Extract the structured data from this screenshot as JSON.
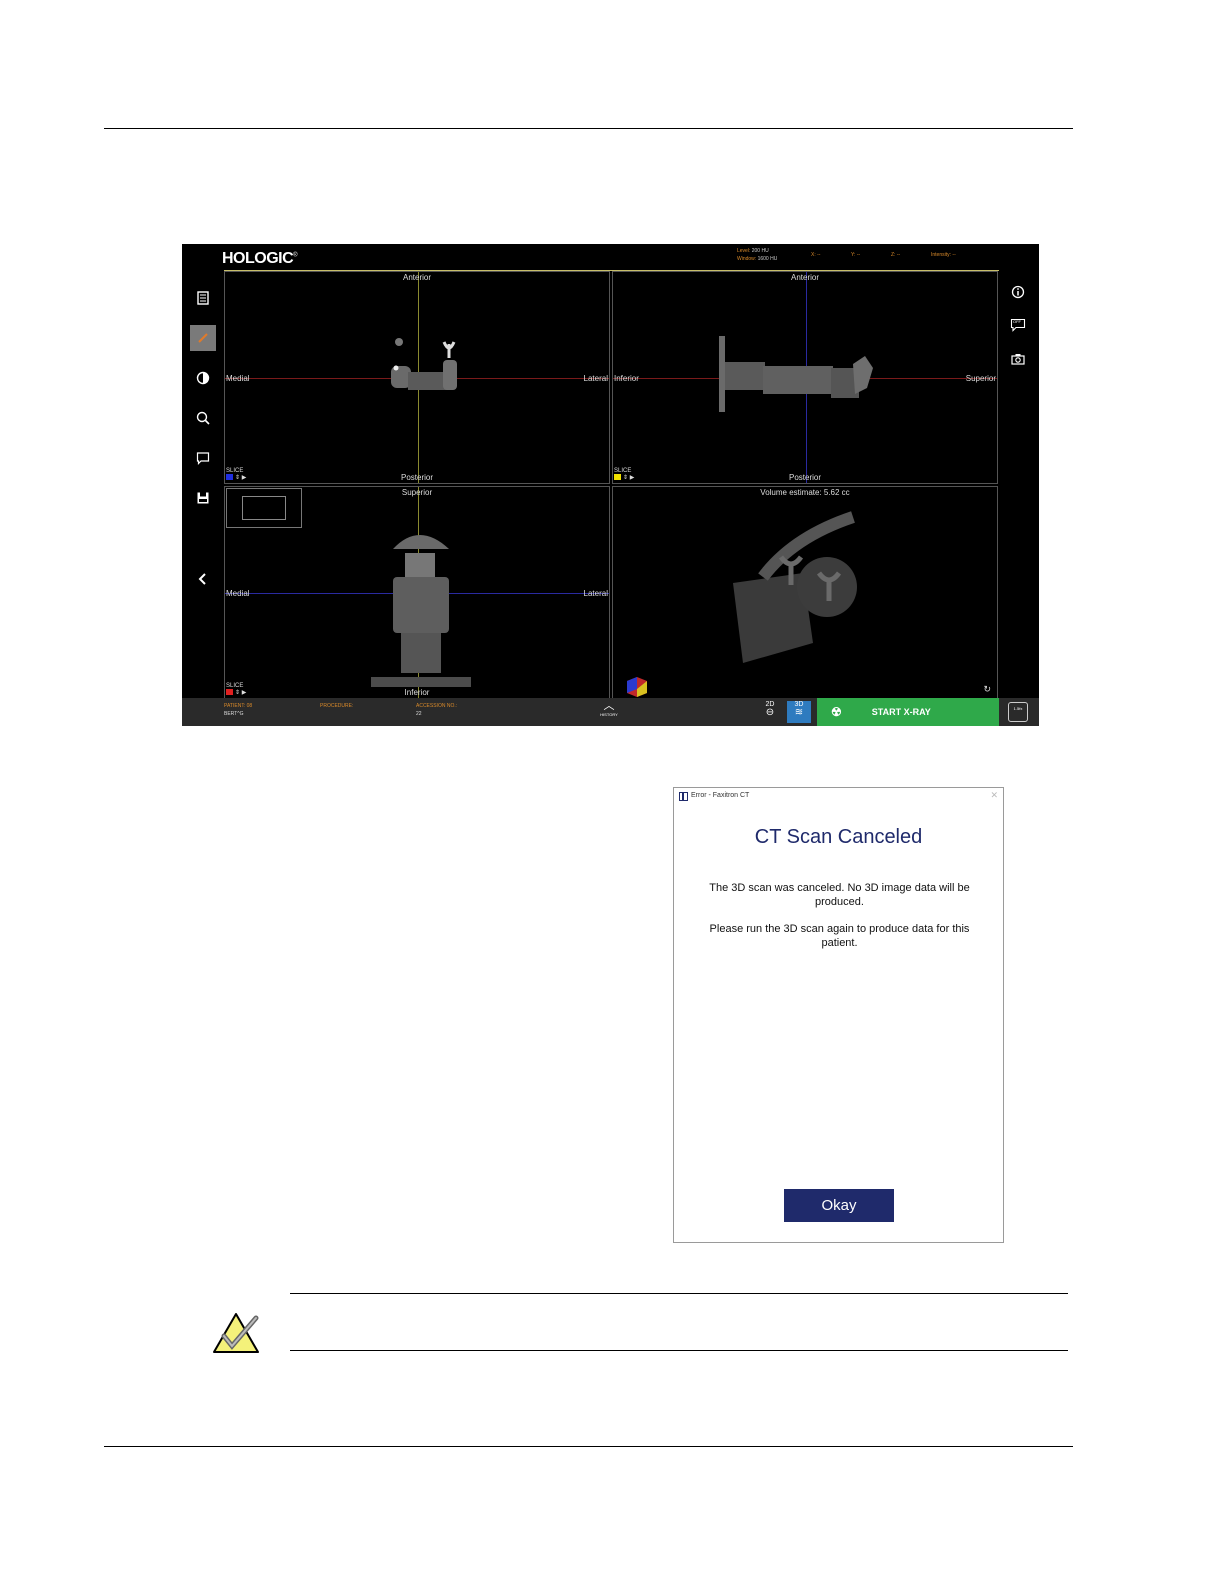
{
  "app": {
    "logo": "HOLOGIC",
    "readouts": {
      "level_label": "Level:",
      "level_value": "200 HU",
      "window_label": "Window:",
      "window_value": "1600 HU",
      "x_label": "X: --",
      "y_label": "Y: --",
      "z_label": "Z: --",
      "intensity_label": "Intensity: --"
    },
    "left_toolbar": [
      {
        "icon": "report-icon"
      },
      {
        "icon": "pencil-icon"
      },
      {
        "icon": "contrast-icon"
      },
      {
        "icon": "zoom-icon"
      },
      {
        "icon": "annotation-icon"
      },
      {
        "icon": "save-pacs-icon"
      },
      {
        "icon": "collapse-icon"
      }
    ],
    "right_toolbar": [
      {
        "icon": "info-icon"
      },
      {
        "icon": "off-annotation-icon",
        "label": "OFF"
      },
      {
        "icon": "camera-icon"
      }
    ],
    "viewports": {
      "axial": {
        "top": "Anterior",
        "bottom": "Posterior",
        "left": "Medial",
        "right": "Lateral",
        "slice_label": "SLICE",
        "slice_color": "#1f2ee0"
      },
      "sagittal": {
        "top": "Anterior",
        "bottom": "Posterior",
        "left": "Inferior",
        "right": "Superior",
        "slice_label": "SLICE",
        "slice_color": "#f2e200"
      },
      "coronal": {
        "top": "Superior",
        "bottom": "Inferior",
        "left": "Medial",
        "right": "Lateral",
        "slice_label": "SLICE",
        "slice_color": "#e02020"
      },
      "volume": {
        "top": "Volume estimate: 5.62 cc"
      }
    },
    "bottom_bar": {
      "patient_label": "PATIENT: 08",
      "patient_value": "BERT^G",
      "procedure_label": "PROCEDURE:",
      "accession_label": "ACCESSION NO.:",
      "accession_value": "22",
      "history_label": "HISTORY",
      "mode_2d": "2D",
      "mode_3d": "3D",
      "start_xray": "START X-RAY",
      "speed_label": "1.5fx"
    }
  },
  "dialog": {
    "title": "Error - Faxitron CT",
    "heading": "CT Scan Canceled",
    "message1": "The 3D scan was canceled. No 3D image data will be produced.",
    "message2": "Please run the 3D scan again to produce data for this patient.",
    "ok_label": "Okay"
  },
  "colors": {
    "dialog_accent": "#1f2a6b",
    "start_xray": "#2fa94a",
    "readout_orange": "#d98a2a"
  }
}
